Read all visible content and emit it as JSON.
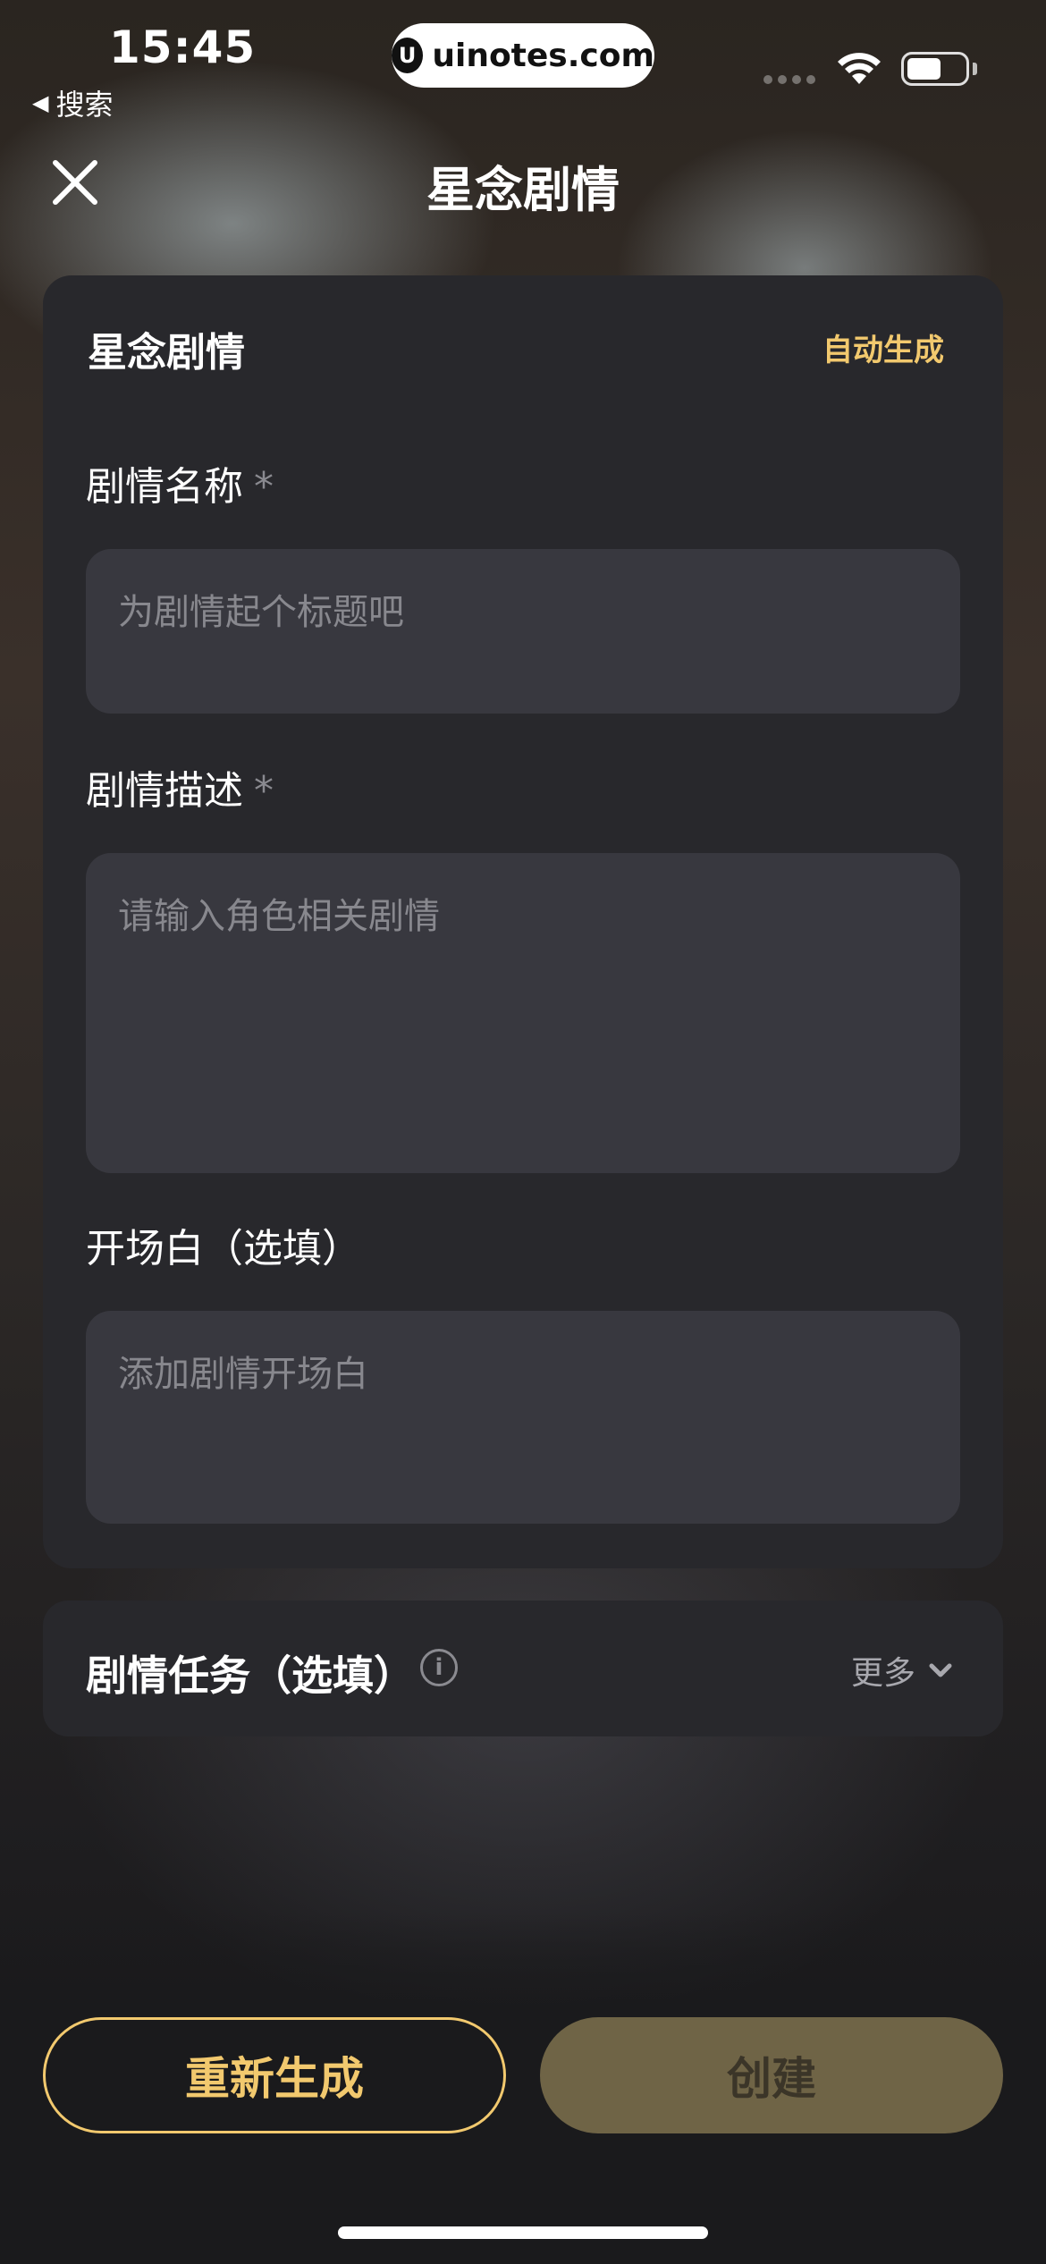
{
  "status_bar": {
    "time": "15:45",
    "back_label": "搜索",
    "url": "uinotes.com"
  },
  "nav": {
    "title": "星念剧情",
    "close_icon": "close-icon"
  },
  "form": {
    "header": "星念剧情",
    "auto_generate": "自动生成",
    "name_label": "剧情名称",
    "name_placeholder": "为剧情起个标题吧",
    "desc_label": "剧情描述",
    "desc_placeholder": "请输入角色相关剧情",
    "opening_label": "开场白（选填）",
    "opening_placeholder": "添加剧情开场白",
    "required_mark": "*"
  },
  "task": {
    "label": "剧情任务（选填）",
    "info_icon": "info-icon",
    "more_label": "更多",
    "more_icon": "chevron-down-icon"
  },
  "actions": {
    "regenerate": "重新生成",
    "create": "创建"
  },
  "colors": {
    "accent": "#f2c96e",
    "card": "#28282c",
    "field": "#38383f",
    "create_disabled": "#6f6446"
  }
}
